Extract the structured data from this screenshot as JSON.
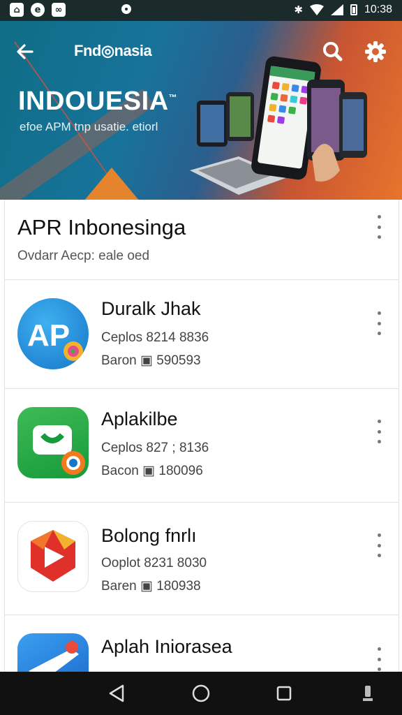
{
  "status_bar": {
    "left_icons": [
      "home-app-icon",
      "refresh-app-icon",
      "link-app-icon",
      "location-icon"
    ],
    "time": "10:38"
  },
  "header": {
    "brand": "Fnd◎nasia",
    "title": "INDOUESIA",
    "trademark": "™",
    "subtitle": "efoe APM tnp usatie. etiorl"
  },
  "section": {
    "title": "APR Inbonesinga",
    "subtitle": "Ovdarr Aecp: eale oed"
  },
  "apps": [
    {
      "name": "Duralk Jhak",
      "line1": "Ceplos  8214 8836",
      "line2": "Baron  ▣  590593",
      "icon": "ap-blue-icon"
    },
    {
      "name": "Aplakilbe",
      "line1": "Ceplos  827 ; 8136",
      "line2": "Bacon  ▣  180096",
      "icon": "green-chat-icon"
    },
    {
      "name": "Bolong fnrlı",
      "line1": "Ooplot  8231 8030",
      "line2": "Baren  ▣  180938",
      "icon": "red-play-icon"
    },
    {
      "name": "Aplah Iniorasea",
      "line1": "",
      "line2": "",
      "icon": "blue-plane-icon"
    }
  ],
  "colors": {
    "status_bar": "#1b2b2b",
    "banner_blue": "#17739a",
    "banner_orange": "#e8742c",
    "nav_bar": "#111111"
  }
}
